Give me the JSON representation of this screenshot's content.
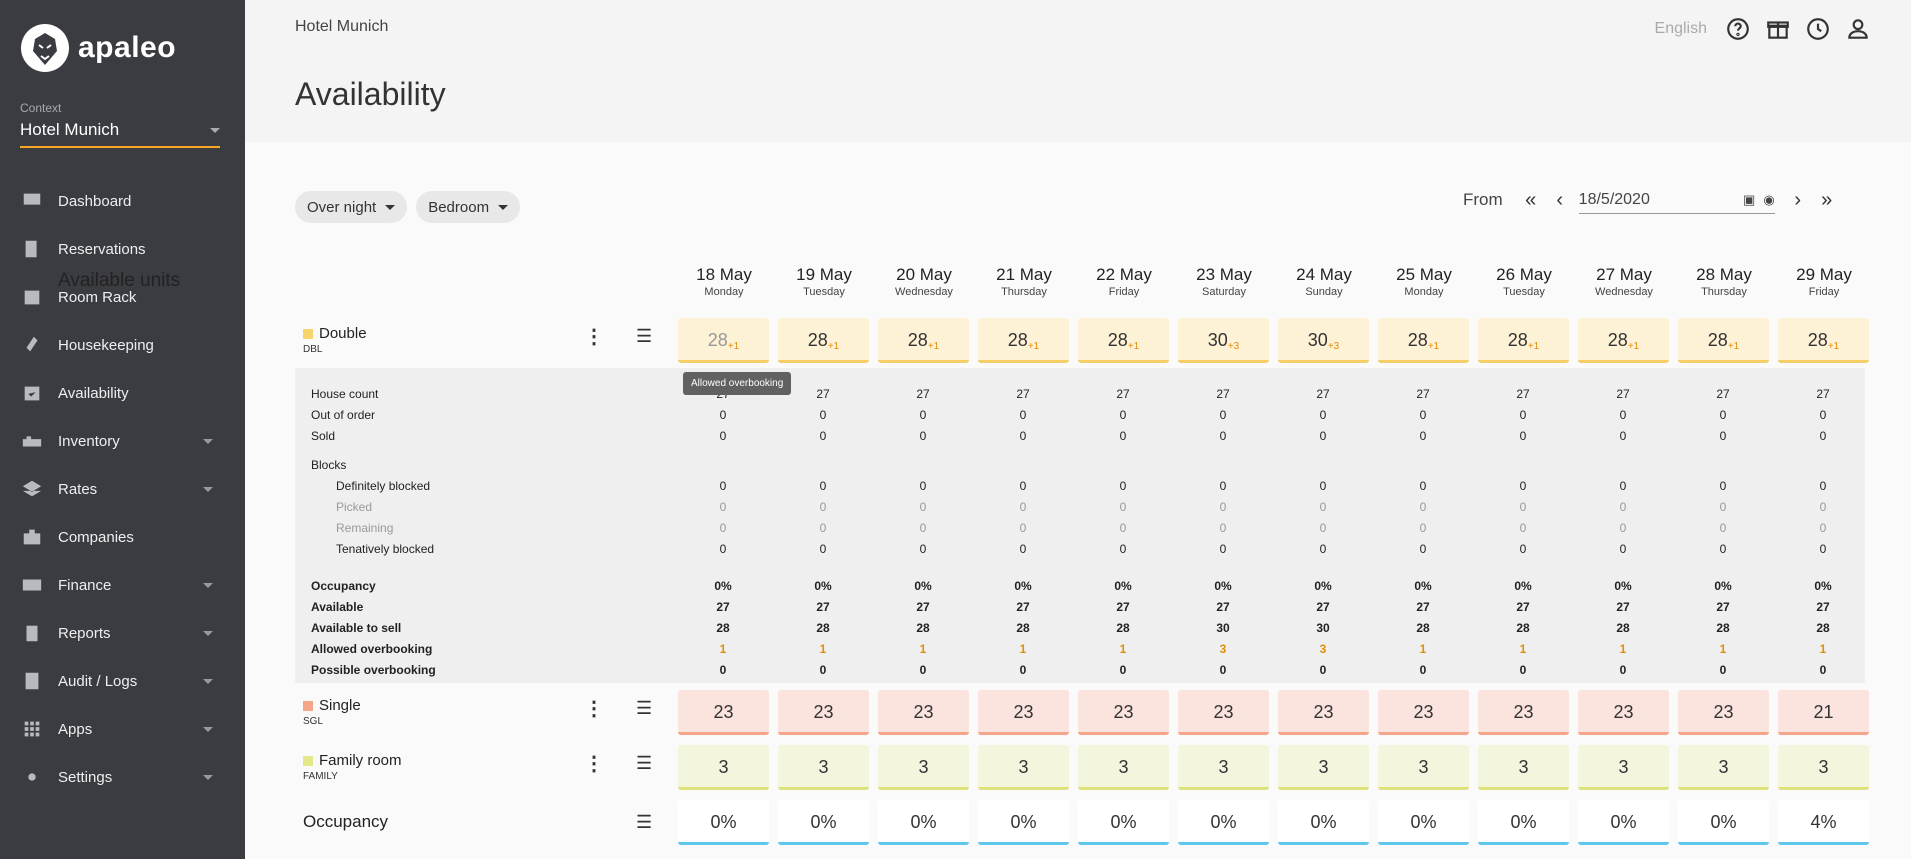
{
  "app": {
    "brand": "apaleo"
  },
  "context": {
    "label": "Context",
    "value": "Hotel Munich"
  },
  "nav": [
    {
      "label": "Dashboard",
      "icon": "dashboard-icon",
      "expand": false
    },
    {
      "label": "Reservations",
      "icon": "book-icon",
      "expand": false
    },
    {
      "label": "Room Rack",
      "icon": "calendar-icon",
      "expand": false
    },
    {
      "label": "Housekeeping",
      "icon": "broom-icon",
      "expand": false
    },
    {
      "label": "Availability",
      "icon": "calendar-check-icon",
      "expand": false
    },
    {
      "label": "Inventory",
      "icon": "bed-icon",
      "expand": true
    },
    {
      "label": "Rates",
      "icon": "layers-icon",
      "expand": true
    },
    {
      "label": "Companies",
      "icon": "briefcase-icon",
      "expand": false
    },
    {
      "label": "Finance",
      "icon": "money-icon",
      "expand": true
    },
    {
      "label": "Reports",
      "icon": "clipboard-icon",
      "expand": true
    },
    {
      "label": "Audit / Logs",
      "icon": "audit-icon",
      "expand": true
    },
    {
      "label": "Apps",
      "icon": "apps-grid-icon",
      "expand": true
    },
    {
      "label": "Settings",
      "icon": "gear-icon",
      "expand": true
    }
  ],
  "header": {
    "hotel": "Hotel Munich",
    "title": "Availability",
    "language": "English"
  },
  "filters": {
    "period": "Over night",
    "unit_group_type": "Bedroom"
  },
  "date_nav": {
    "from_label": "From",
    "date": "18/5/2020"
  },
  "grid": {
    "title": "Available units",
    "days": [
      {
        "date": "18 May",
        "day": "Monday"
      },
      {
        "date": "19 May",
        "day": "Tuesday"
      },
      {
        "date": "20 May",
        "day": "Wednesday"
      },
      {
        "date": "21 May",
        "day": "Thursday"
      },
      {
        "date": "22 May",
        "day": "Friday"
      },
      {
        "date": "23 May",
        "day": "Saturday"
      },
      {
        "date": "24 May",
        "day": "Sunday"
      },
      {
        "date": "25 May",
        "day": "Monday"
      },
      {
        "date": "26 May",
        "day": "Tuesday"
      },
      {
        "date": "27 May",
        "day": "Wednesday"
      },
      {
        "date": "28 May",
        "day": "Thursday"
      },
      {
        "date": "29 May",
        "day": "Friday"
      }
    ],
    "double": {
      "name": "Double",
      "code": "DBL",
      "color": "#f7d56b",
      "bg": "#fdf1d6",
      "border": "#f5cf66",
      "values": [
        "28",
        "28",
        "28",
        "28",
        "28",
        "30",
        "30",
        "28",
        "28",
        "28",
        "28",
        "28"
      ],
      "extra": [
        "+1",
        "+1",
        "+1",
        "+1",
        "+1",
        "+3",
        "+3",
        "+1",
        "+1",
        "+1",
        "+1",
        "+1"
      ]
    },
    "tooltip": "Allowed overbooking",
    "details": [
      {
        "label": "House count",
        "style": "",
        "values": [
          "27",
          "27",
          "27",
          "27",
          "27",
          "27",
          "27",
          "27",
          "27",
          "27",
          "27",
          "27"
        ]
      },
      {
        "label": "Out of order",
        "style": "",
        "values": [
          "0",
          "0",
          "0",
          "0",
          "0",
          "0",
          "0",
          "0",
          "0",
          "0",
          "0",
          "0"
        ]
      },
      {
        "label": "Sold",
        "style": "",
        "values": [
          "0",
          "0",
          "0",
          "0",
          "0",
          "0",
          "0",
          "0",
          "0",
          "0",
          "0",
          "0"
        ]
      },
      {
        "label": "Blocks",
        "style": "",
        "values": []
      },
      {
        "label": "Definitely blocked",
        "style": "ind",
        "values": [
          "0",
          "0",
          "0",
          "0",
          "0",
          "0",
          "0",
          "0",
          "0",
          "0",
          "0",
          "0"
        ]
      },
      {
        "label": "Picked",
        "style": "ind gray",
        "values": [
          "0",
          "0",
          "0",
          "0",
          "0",
          "0",
          "0",
          "0",
          "0",
          "0",
          "0",
          "0"
        ]
      },
      {
        "label": "Remaining",
        "style": "ind gray",
        "values": [
          "0",
          "0",
          "0",
          "0",
          "0",
          "0",
          "0",
          "0",
          "0",
          "0",
          "0",
          "0"
        ]
      },
      {
        "label": "Tenatively blocked",
        "style": "ind",
        "values": [
          "0",
          "0",
          "0",
          "0",
          "0",
          "0",
          "0",
          "0",
          "0",
          "0",
          "0",
          "0"
        ]
      },
      {
        "label": "Occupancy",
        "style": "b",
        "values": [
          "0%",
          "0%",
          "0%",
          "0%",
          "0%",
          "0%",
          "0%",
          "0%",
          "0%",
          "0%",
          "0%",
          "0%"
        ]
      },
      {
        "label": "Available",
        "style": "b",
        "values": [
          "27",
          "27",
          "27",
          "27",
          "27",
          "27",
          "27",
          "27",
          "27",
          "27",
          "27",
          "27"
        ]
      },
      {
        "label": "Available to sell",
        "style": "b",
        "values": [
          "28",
          "28",
          "28",
          "28",
          "28",
          "30",
          "30",
          "28",
          "28",
          "28",
          "28",
          "28"
        ]
      },
      {
        "label": "Allowed overbooking",
        "style": "b o",
        "values": [
          "1",
          "1",
          "1",
          "1",
          "1",
          "3",
          "3",
          "1",
          "1",
          "1",
          "1",
          "1"
        ]
      },
      {
        "label": "Possible overbooking",
        "style": "b",
        "values": [
          "0",
          "0",
          "0",
          "0",
          "0",
          "0",
          "0",
          "0",
          "0",
          "0",
          "0",
          "0"
        ]
      }
    ],
    "single": {
      "name": "Single",
      "code": "SGL",
      "color": "#f4a58a",
      "bg": "#fbe4dd",
      "border": "#f4a58a",
      "values": [
        "23",
        "23",
        "23",
        "23",
        "23",
        "23",
        "23",
        "23",
        "23",
        "23",
        "23",
        "21"
      ]
    },
    "family": {
      "name": "Family room",
      "code": "FAMILY",
      "color": "#e3e88a",
      "bg": "#f3f5dd",
      "border": "#dde27d",
      "values": [
        "3",
        "3",
        "3",
        "3",
        "3",
        "3",
        "3",
        "3",
        "3",
        "3",
        "3",
        "3"
      ]
    },
    "occupancy": {
      "label": "Occupancy",
      "bg": "#ffffff",
      "border": "#5ec8ea",
      "values": [
        "0%",
        "0%",
        "0%",
        "0%",
        "0%",
        "0%",
        "0%",
        "0%",
        "0%",
        "0%",
        "0%",
        "4%"
      ]
    }
  }
}
